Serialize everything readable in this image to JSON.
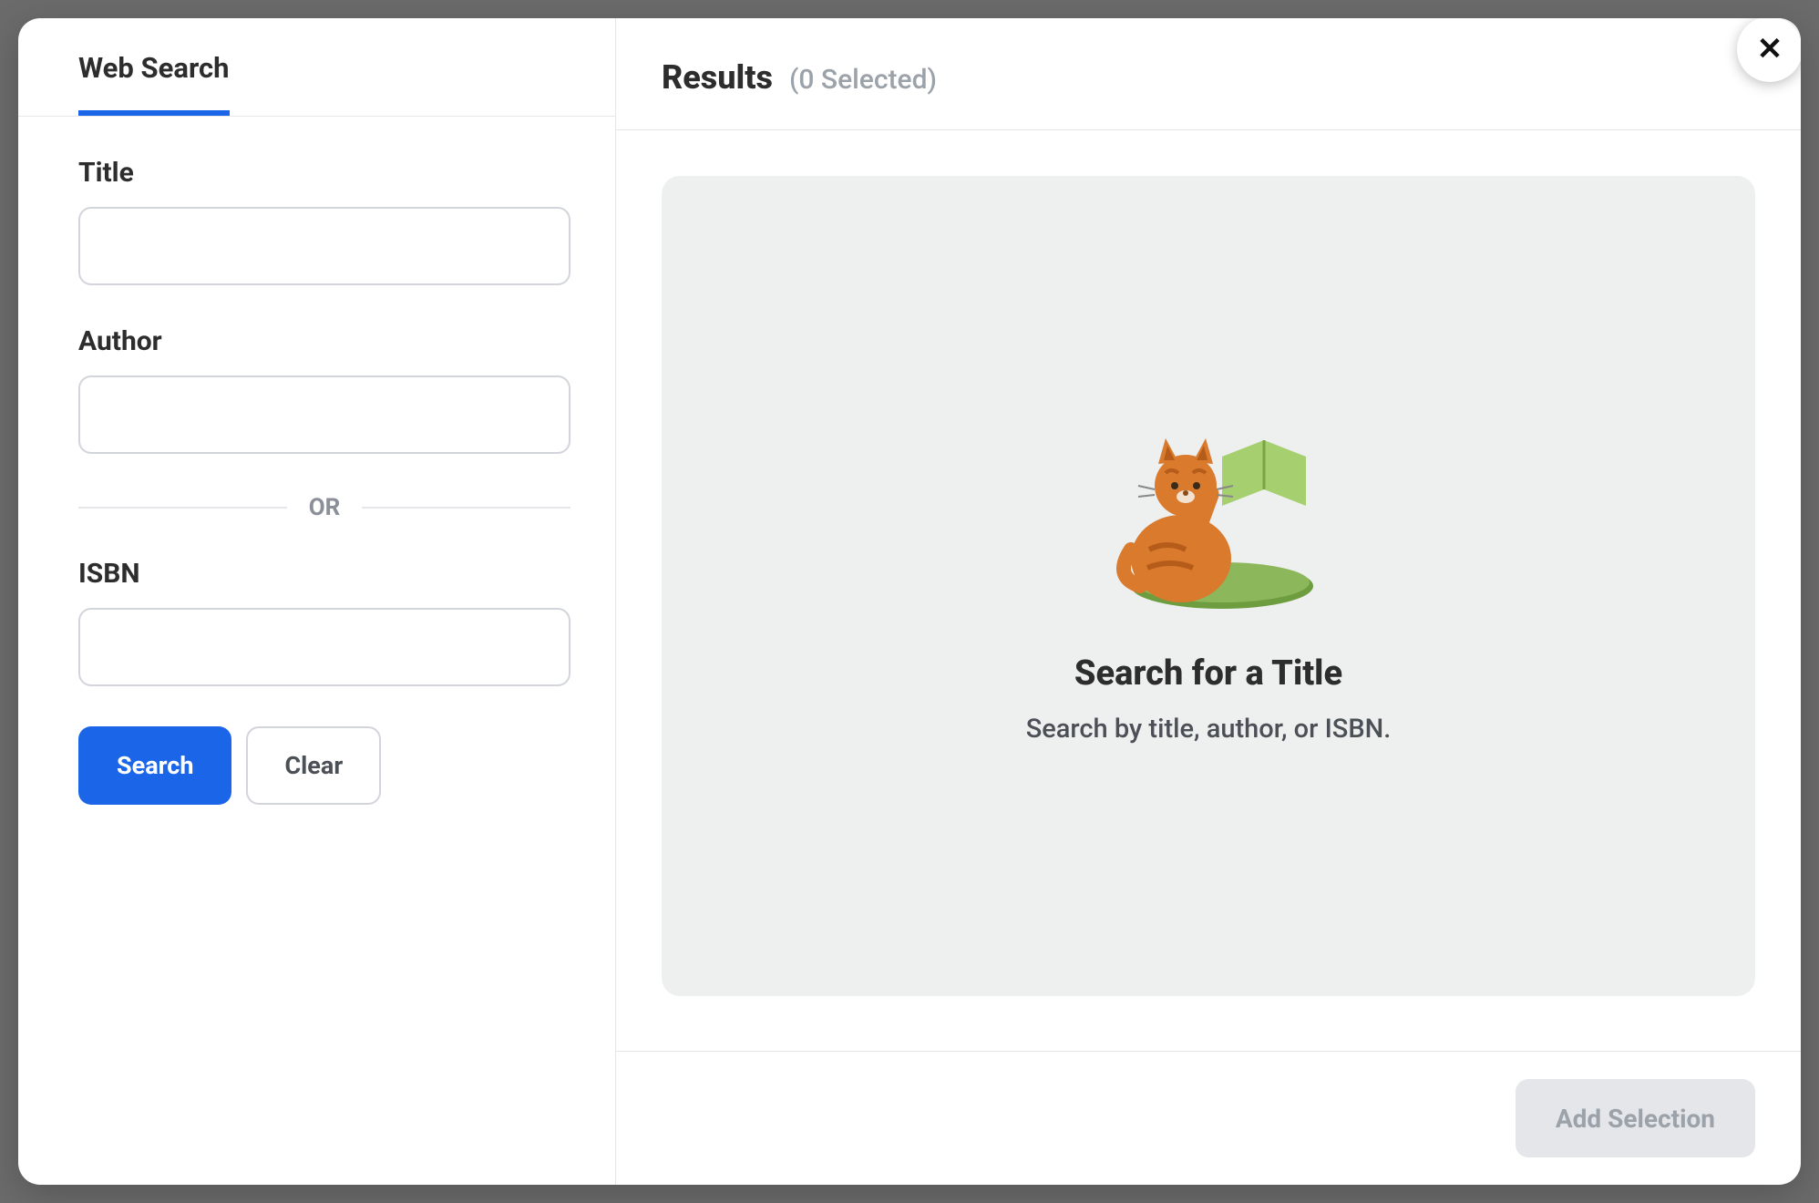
{
  "left": {
    "tab_label": "Web Search",
    "fields": {
      "title_label": "Title",
      "title_value": "",
      "author_label": "Author",
      "author_value": "",
      "isbn_label": "ISBN",
      "isbn_value": ""
    },
    "separator": "OR",
    "buttons": {
      "search": "Search",
      "clear": "Clear"
    }
  },
  "results": {
    "heading": "Results",
    "selected_text": "(0 Selected)",
    "empty_title": "Search for a Title",
    "empty_sub": "Search by title, author, or ISBN.",
    "add_selection": "Add Selection"
  },
  "close_glyph": "✕"
}
